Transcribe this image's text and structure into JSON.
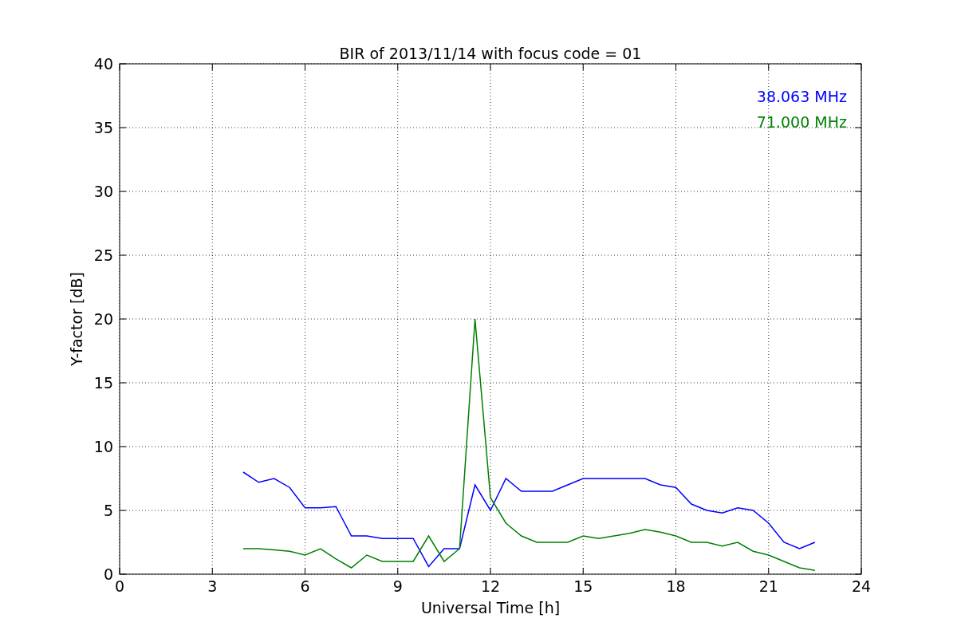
{
  "figure": {
    "chart_data": {
      "type": "line",
      "title": "BIR of 2013/11/14 with focus code = 01",
      "xlabel": "Universal Time [h]",
      "ylabel": "Y-factor [dB]",
      "x": [
        4,
        4.5,
        5,
        5.5,
        6,
        6.5,
        7,
        7.5,
        8,
        8.5,
        9,
        9.5,
        10,
        10.5,
        11,
        11.5,
        12,
        12.5,
        13,
        13.5,
        14,
        14.5,
        15,
        15.5,
        16,
        16.5,
        17,
        17.5,
        18,
        18.5,
        19,
        19.5,
        20,
        20.5,
        21,
        21.5,
        22,
        22.5
      ],
      "series": [
        {
          "name": "38.063 MHz",
          "color": "#0000ff",
          "values": [
            8,
            7.2,
            7.5,
            6.8,
            5.2,
            5.2,
            5.3,
            3,
            3,
            2.8,
            2.8,
            2.8,
            0.6,
            2,
            2,
            7,
            5,
            7.5,
            6.5,
            6.5,
            6.5,
            7,
            7.5,
            7.5,
            7.5,
            7.5,
            7.5,
            7,
            6.8,
            5.5,
            5,
            4.8,
            5.2,
            5,
            4,
            2.5,
            2,
            2.5
          ]
        },
        {
          "name": "71.000 MHz",
          "color": "#008000",
          "values": [
            2,
            2,
            1.9,
            1.8,
            1.5,
            2,
            1.2,
            0.5,
            1.5,
            1,
            1,
            1,
            3,
            1,
            2,
            20,
            6,
            4,
            3,
            2.5,
            2.5,
            2.5,
            3,
            2.8,
            3,
            3.2,
            3.5,
            3.3,
            3,
            2.5,
            2.5,
            2.2,
            2.5,
            1.8,
            1.5,
            1,
            0.5,
            0.3
          ]
        }
      ],
      "xlim": [
        0,
        24
      ],
      "ylim": [
        0,
        40
      ],
      "xticks": [
        0,
        3,
        6,
        9,
        12,
        15,
        18,
        21,
        24
      ],
      "yticks": [
        0,
        5,
        10,
        15,
        20,
        25,
        30,
        35,
        40
      ],
      "grid": true
    }
  }
}
